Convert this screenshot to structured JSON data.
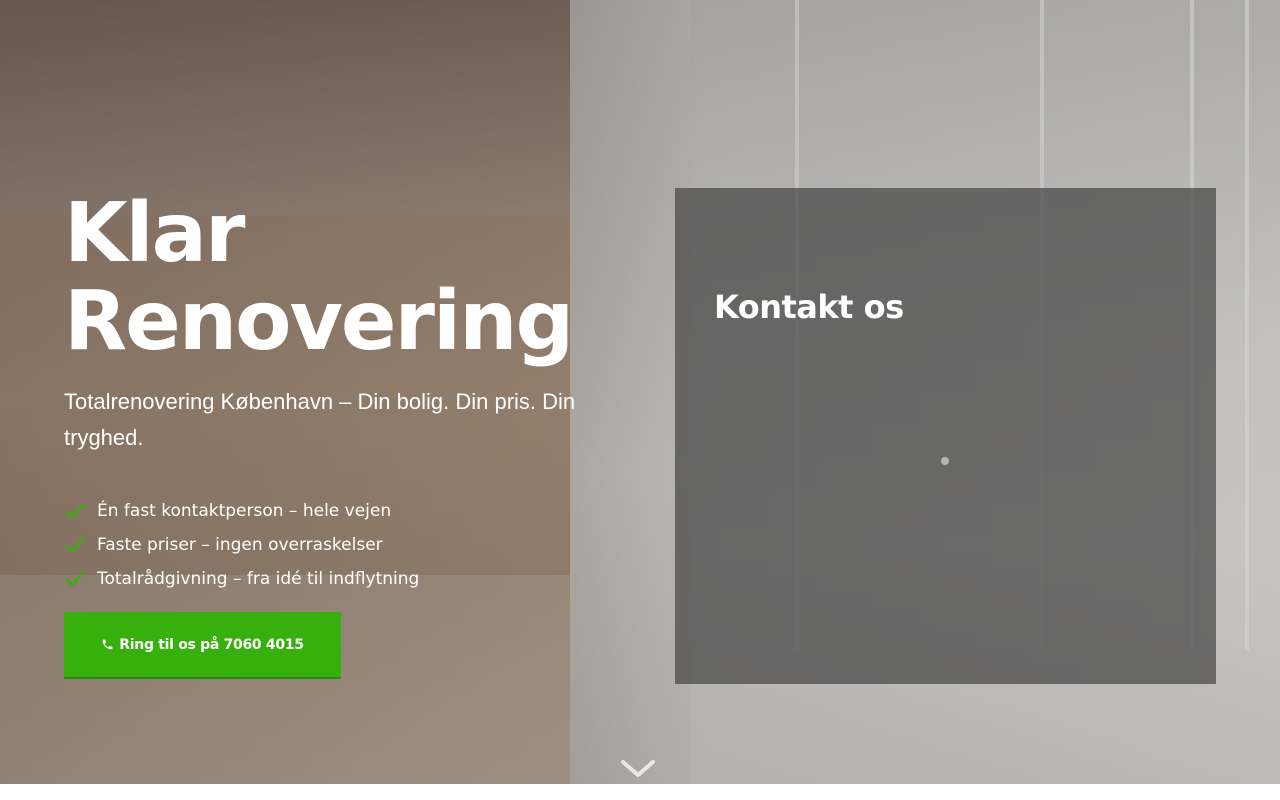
{
  "hero": {
    "title_line1": "Klar",
    "title_line2": "Renovering",
    "subtitle": "Totalrenovering København – Din bolig. Din pris. Din tryghed.",
    "features": [
      {
        "icon": "check-icon",
        "text": "Én fast kontaktperson – hele vejen"
      },
      {
        "icon": "check-icon",
        "text": "Faste priser – ingen overraskelser"
      },
      {
        "icon": "check-icon",
        "text": "Totalrådgivning – fra idé til indflytning"
      }
    ],
    "cta": {
      "icon": "phone-icon",
      "label": "Ring til os på 7060 4015"
    }
  },
  "contact": {
    "title": "Kontakt os"
  },
  "scroll": {
    "icon": "chevron-down-icon"
  },
  "colors": {
    "accent": "#37b00e",
    "check": "#37b00e",
    "text": "#ffffff",
    "contact_bg": "#464646"
  }
}
